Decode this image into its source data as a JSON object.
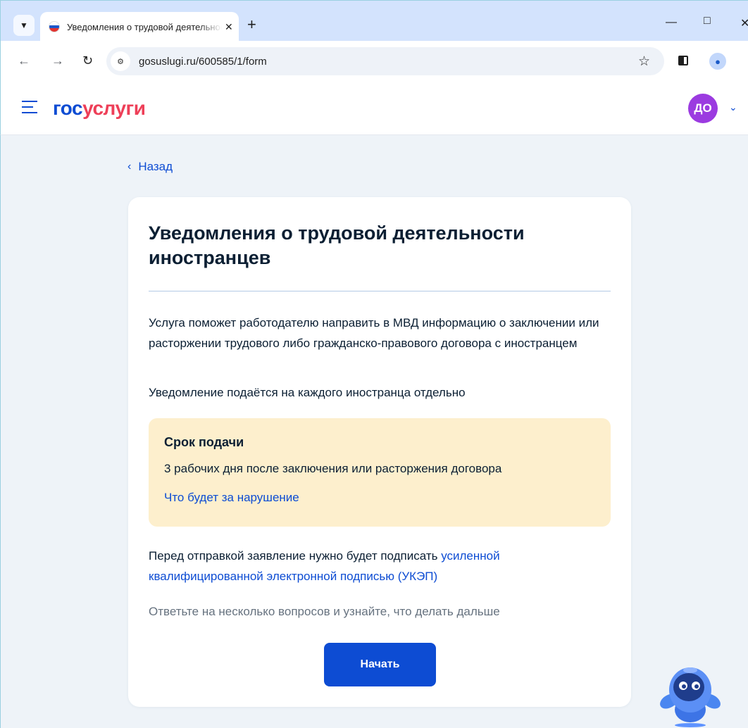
{
  "browser": {
    "tab_title": "Уведомления о трудовой деятельности иностранцев",
    "url": "gosuslugi.ru/600585/1/form"
  },
  "header": {
    "logo_part1": "гос",
    "logo_part2": "услуги",
    "avatar_initials": "ДО"
  },
  "main": {
    "back_label": "Назад",
    "title": "Уведомления о трудовой деятельности иностранцев",
    "description": "Услуга поможет работодателю направить в МВД информацию о заключении или расторжении трудового либо гражданско-правового договора с иностранцем",
    "note": "Уведомление подаётся на каждого иностранца отдельно",
    "deadline": {
      "heading": "Срок подачи",
      "text": "3 рабочих дня после заключения или расторжения договора",
      "link": "Что будет за нарушение"
    },
    "sign_text": "Перед отправкой заявление нужно будет подписать ",
    "sign_link": "усиленной квалифицированной электронной подписью (УКЭП)",
    "hint": "Ответьте на несколько вопросов и узнайте, что делать дальше",
    "start_button": "Начать"
  },
  "colors": {
    "brand_blue": "#0d4cd3",
    "brand_red": "#ee3f58",
    "avatar": "#9b3be0",
    "deadline_bg": "#fdefcd"
  }
}
